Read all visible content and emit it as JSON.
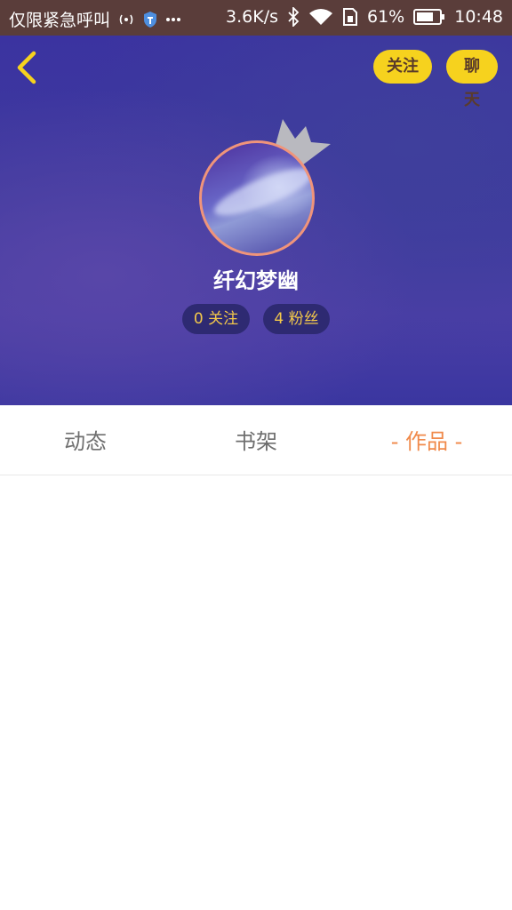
{
  "status_bar": {
    "carrier": "仅限紧急呼叫",
    "speed": "3.6K/s",
    "battery": "61%",
    "time": "10:48",
    "icons": [
      "signal-icon",
      "shield-icon",
      "more-icon",
      "bluetooth-icon",
      "wifi-icon",
      "sim-icon",
      "battery-icon"
    ]
  },
  "header": {
    "follow_label": "关注",
    "chat_label": "聊天",
    "username": "纤幻梦幽",
    "following_label": "0 关注",
    "fans_label": "4 粉丝",
    "accent": "#f6d21e"
  },
  "tabs": {
    "items": [
      {
        "label": "动态"
      },
      {
        "label": "书架"
      },
      {
        "label": "作品"
      }
    ],
    "active_dash": "-",
    "active_color": "#f08a4b"
  }
}
